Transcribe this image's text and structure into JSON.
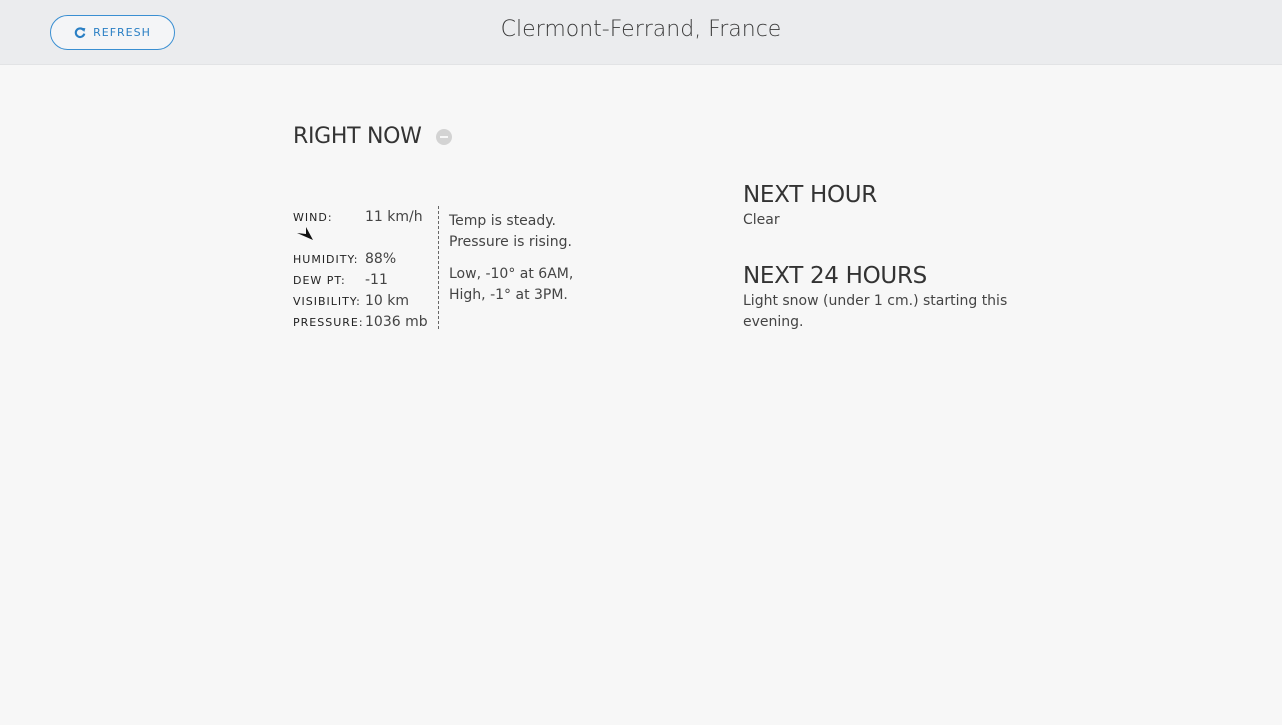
{
  "header": {
    "refresh_label": "REFRESH",
    "location": "Clermont-Ferrand, France"
  },
  "right_now": {
    "title": "RIGHT NOW",
    "conditions": {
      "wind_label": "WIND:",
      "wind_value": "11 km/h",
      "humidity_label": "HUMIDITY:",
      "humidity_value": "88%",
      "dew_label": "DEW PT:",
      "dew_value": "-11",
      "visibility_label": "VISIBILITY:",
      "visibility_value": "10 km",
      "pressure_label": "PRESSURE:",
      "pressure_value": "1036 mb"
    },
    "trend": {
      "temp": "Temp is steady.",
      "pressure": "Pressure is rising.",
      "low": "Low, -10° at 6AM,",
      "high": "High, -1° at 3PM."
    }
  },
  "next_hour": {
    "title": "NEXT HOUR",
    "text": "Clear"
  },
  "next_24": {
    "title": "NEXT 24 HOURS",
    "text": "Light snow (under 1 cm.) starting this evening."
  },
  "icons": {
    "refresh": "refresh-icon",
    "collapse": "minus-circle-icon",
    "wind_direction": "wind-direction-arrow-icon"
  },
  "colors": {
    "accent": "#2a7fc4",
    "header_bg": "#ebecee",
    "page_bg": "#f7f7f7"
  }
}
